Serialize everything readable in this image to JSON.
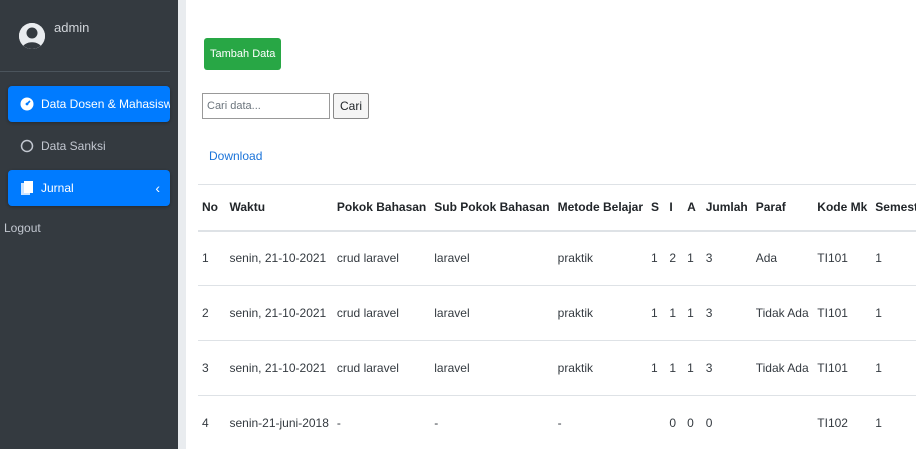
{
  "sidebar": {
    "user_name": "admin",
    "items": [
      {
        "label": "Data Dosen & Mahasiswa",
        "icon": "tachometer-icon",
        "active": true,
        "arrow": ""
      },
      {
        "label": "Data Sanksi",
        "icon": "circle-icon",
        "active": false,
        "arrow": ""
      },
      {
        "label": "Jurnal",
        "icon": "file-icon",
        "active": true,
        "arrow": "‹"
      }
    ],
    "logout_label": "Logout"
  },
  "toolbar": {
    "add_label": "Tambah Data",
    "search_placeholder": "Cari data...",
    "search_label": "Cari",
    "download_label": "Download"
  },
  "table": {
    "headers": [
      "No",
      "Waktu",
      "Pokok Bahasan",
      "Sub Pokok Bahasan",
      "Metode Belajar",
      "S",
      "I",
      "A",
      "Jumlah",
      "Paraf",
      "Kode Mk",
      "Semester"
    ],
    "rows": [
      [
        "1",
        "senin, 21-10-2021",
        "crud laravel",
        "laravel",
        "praktik",
        "1",
        "2",
        "1",
        "3",
        "Ada",
        "TI101",
        "1"
      ],
      [
        "2",
        "senin, 21-10-2021",
        "crud laravel",
        "laravel",
        "praktik",
        "1",
        "1",
        "1",
        "3",
        "Tidak Ada",
        "TI101",
        "1"
      ],
      [
        "3",
        "senin, 21-10-2021",
        "crud laravel",
        "laravel",
        "praktik",
        "1",
        "1",
        "1",
        "3",
        "Tidak Ada",
        "TI101",
        "1"
      ],
      [
        "4",
        "senin-21-juni-2018",
        "-",
        "-",
        "-",
        "",
        "0",
        "0",
        "0",
        "",
        "TI102",
        "1"
      ]
    ]
  },
  "colors": {
    "sidebar_bg": "#343a40",
    "active_bg": "#007bff",
    "add_button_bg": "#28a745",
    "link": "#1a73d9"
  }
}
